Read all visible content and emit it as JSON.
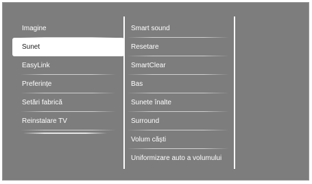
{
  "menu": {
    "left_items": [
      {
        "label": "Imagine"
      },
      {
        "label": "Sunet"
      },
      {
        "label": "EasyLink"
      },
      {
        "label": "Preferințe"
      },
      {
        "label": "Setări fabrică"
      },
      {
        "label": "Reinstalare TV"
      }
    ],
    "selected_left": "Sunet",
    "right_items": [
      {
        "label": "Smart sound"
      },
      {
        "label": "Resetare"
      },
      {
        "label": "SmartClear"
      },
      {
        "label": "Bas"
      },
      {
        "label": "Sunete înalte"
      },
      {
        "label": "Surround"
      },
      {
        "label": "Volum căști"
      },
      {
        "label": "Uniformizare auto a volumului"
      }
    ]
  },
  "colors": {
    "background": "#7d7d7d",
    "text": "#ffffff",
    "selected_bg": "#ffffff",
    "selected_text": "#1a1a1a"
  }
}
